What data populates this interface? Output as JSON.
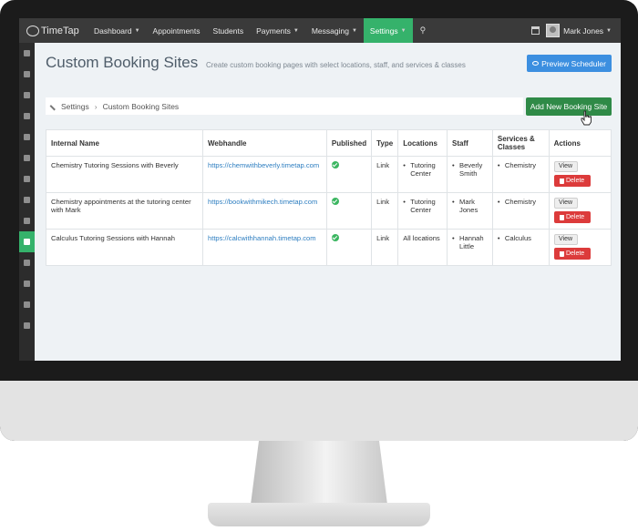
{
  "app": {
    "name": "TimeTap"
  },
  "nav": {
    "items": [
      {
        "label": "Dashboard",
        "dropdown": true
      },
      {
        "label": "Appointments",
        "dropdown": false
      },
      {
        "label": "Students",
        "dropdown": false
      },
      {
        "label": "Payments",
        "dropdown": true
      },
      {
        "label": "Messaging",
        "dropdown": true
      },
      {
        "label": "Settings",
        "dropdown": true,
        "active": true
      }
    ],
    "user_name": "Mark Jones"
  },
  "page": {
    "title": "Custom Booking Sites",
    "subtitle": "Create custom booking pages with select locations, staff, and services & classes",
    "preview_button": "Preview Scheduler",
    "add_button": "Add New Booking Site",
    "breadcrumb": [
      "Settings",
      "Custom Booking Sites"
    ]
  },
  "table": {
    "headers": [
      "Internal Name",
      "Webhandle",
      "Published",
      "Type",
      "Locations",
      "Staff",
      "Services & Classes",
      "Actions"
    ],
    "view_label": "View",
    "delete_label": "Delete",
    "rows": [
      {
        "name": "Chemistry Tutoring Sessions with Beverly",
        "webhandle": "https://chemwithbeverly.timetap.com",
        "published": true,
        "type": "Link",
        "locations": [
          "Tutoring Center"
        ],
        "locations_bullet": true,
        "staff": [
          "Beverly Smith"
        ],
        "services": [
          "Chemistry"
        ]
      },
      {
        "name": "Chemistry appointments at the tutoring center with Mark",
        "webhandle": "https://bookwithmikech.timetap.com",
        "published": true,
        "type": "Link",
        "locations": [
          "Tutoring Center"
        ],
        "locations_bullet": true,
        "staff": [
          "Mark Jones"
        ],
        "services": [
          "Chemistry"
        ]
      },
      {
        "name": "Calculus Tutoring Sessions with Hannah",
        "webhandle": "https://calcwithhannah.timetap.com",
        "published": true,
        "type": "Link",
        "locations": [
          "All locations"
        ],
        "locations_bullet": false,
        "staff": [
          "Hannah Little"
        ],
        "services": [
          "Calculus"
        ]
      }
    ]
  },
  "colors": {
    "nav_active": "#35b26b",
    "preview_button": "#3c8fe0",
    "add_button": "#2f8a47",
    "delete_button": "#dc3b3b",
    "link": "#2f7fc1"
  }
}
